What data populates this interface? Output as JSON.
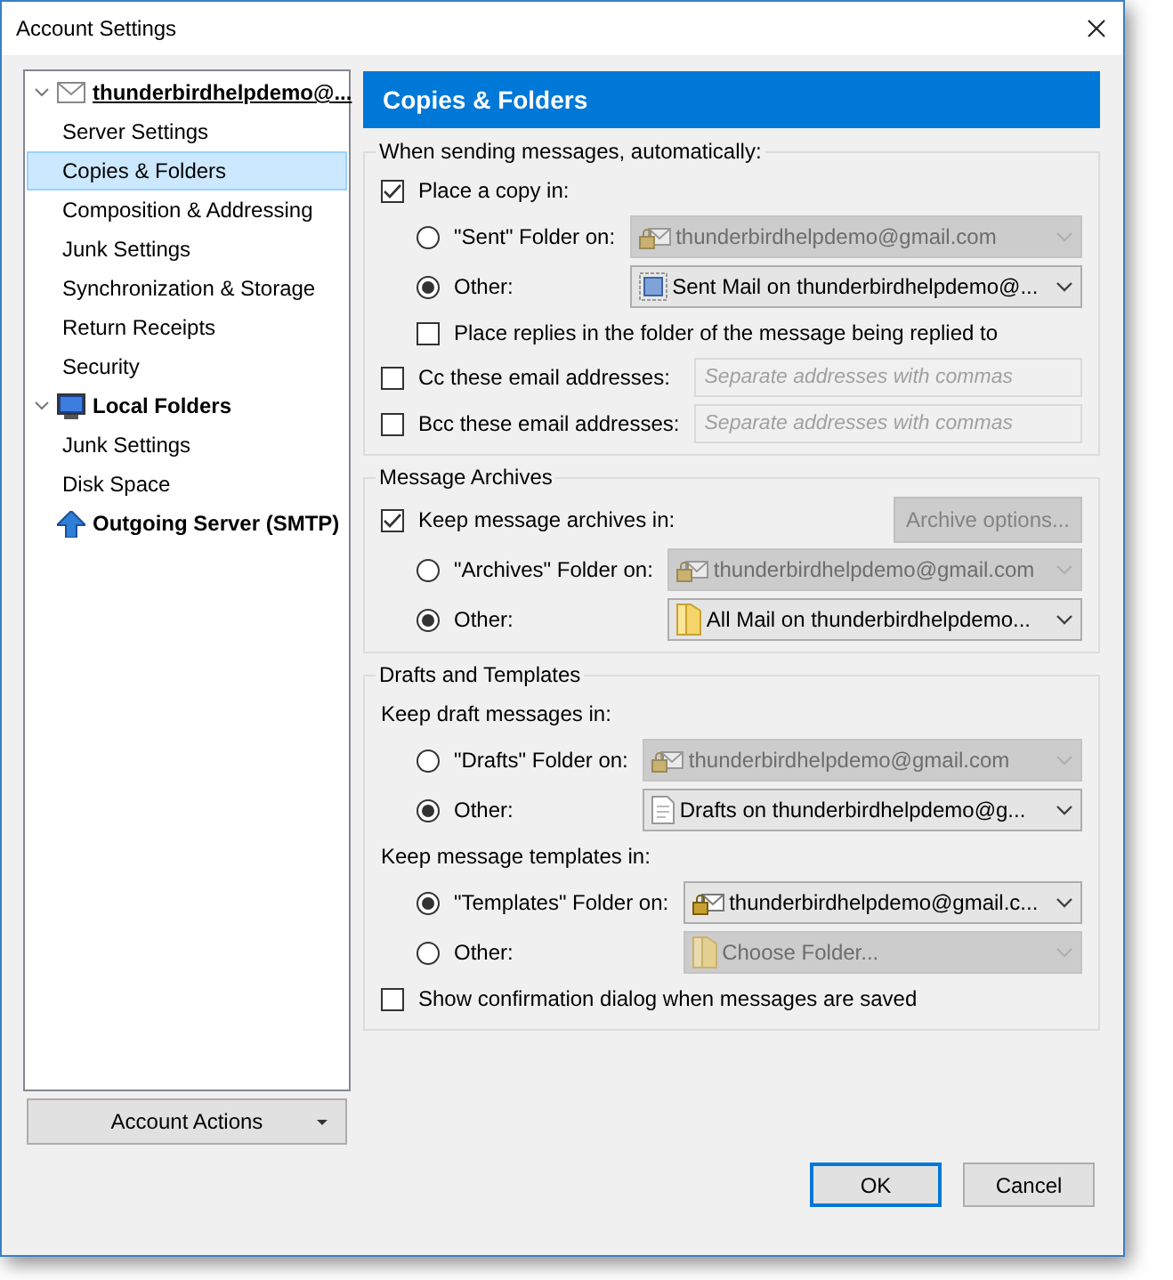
{
  "window": {
    "title": "Account Settings"
  },
  "sidebar": {
    "items": [
      {
        "label": "thunderbirdhelpdemo@...",
        "kind": "mail",
        "expanded": true,
        "selected": false,
        "children": [
          {
            "label": "Server Settings",
            "selected": false
          },
          {
            "label": "Copies & Folders",
            "selected": true
          },
          {
            "label": "Composition & Addressing",
            "selected": false
          },
          {
            "label": "Junk Settings",
            "selected": false
          },
          {
            "label": "Synchronization & Storage",
            "selected": false
          },
          {
            "label": "Return Receipts",
            "selected": false
          },
          {
            "label": "Security",
            "selected": false
          }
        ]
      },
      {
        "label": "Local Folders",
        "kind": "computer",
        "expanded": true,
        "selected": false,
        "children": [
          {
            "label": "Junk Settings",
            "selected": false
          },
          {
            "label": "Disk Space",
            "selected": false
          }
        ]
      },
      {
        "label": "Outgoing Server (SMTP)",
        "kind": "server",
        "selected": false
      }
    ],
    "actions_button": "Account Actions"
  },
  "panel": {
    "title": "Copies & Folders",
    "groups": [
      {
        "legend": "When sending messages, automatically:",
        "rows": [
          {
            "kind": "checkbox",
            "label": "Place a copy in:",
            "checked": true
          },
          {
            "kind": "radio",
            "label": "\"Sent\" Folder on:",
            "selected": false,
            "select": {
              "value": "thunderbirdhelpdemo@gmail.com",
              "kind": "account",
              "disabled": true
            }
          },
          {
            "kind": "radio",
            "label": "Other:",
            "selected": true,
            "select": {
              "value": "Sent Mail on thunderbirdhelpdemo@...",
              "kind": "sent",
              "disabled": false
            }
          },
          {
            "kind": "sub_checkbox",
            "label": "Place replies in the folder of the message being replied to",
            "checked": false
          },
          {
            "kind": "checkbox_input",
            "label": "Cc these email addresses:",
            "checked": false,
            "placeholder": "Separate addresses with commas"
          },
          {
            "kind": "checkbox_input",
            "label": "Bcc these email addresses:",
            "checked": false,
            "placeholder": "Separate addresses with commas"
          }
        ]
      },
      {
        "legend": "Message Archives",
        "rows": [
          {
            "kind": "checkbox",
            "label": "Keep message archives in:",
            "checked": true,
            "button": {
              "label": "Archive options...",
              "disabled": true
            }
          },
          {
            "kind": "radio",
            "label": "\"Archives\" Folder on:",
            "selected": false,
            "select": {
              "value": "thunderbirdhelpdemo@gmail.com",
              "kind": "account",
              "disabled": true
            }
          },
          {
            "kind": "radio",
            "label": "Other:",
            "selected": true,
            "select": {
              "value": "All Mail on thunderbirdhelpdemo...",
              "kind": "folder",
              "disabled": false
            }
          }
        ]
      },
      {
        "legend": "Drafts and Templates",
        "rows": [
          {
            "kind": "heading",
            "label": "Keep draft messages in:"
          },
          {
            "kind": "radio",
            "label": "\"Drafts\" Folder on:",
            "selected": false,
            "select": {
              "value": "thunderbirdhelpdemo@gmail.com",
              "kind": "account",
              "disabled": true
            }
          },
          {
            "kind": "radio",
            "label": "Other:",
            "selected": true,
            "select": {
              "value": "Drafts on thunderbirdhelpdemo@g...",
              "kind": "draft",
              "disabled": false
            }
          },
          {
            "kind": "heading",
            "label": "Keep message templates in:"
          },
          {
            "kind": "radio",
            "label": "\"Templates\" Folder on:",
            "selected": true,
            "select": {
              "value": "thunderbirdhelpdemo@gmail.c...",
              "kind": "account",
              "disabled": false
            }
          },
          {
            "kind": "radio",
            "label": "Other:",
            "selected": false,
            "select": {
              "value": "Choose Folder...",
              "kind": "folder",
              "disabled": true
            }
          },
          {
            "kind": "checkbox",
            "label": "Show confirmation dialog when messages are saved",
            "checked": false
          }
        ]
      }
    ]
  },
  "buttons": [
    {
      "label": "OK",
      "default": true
    },
    {
      "label": "Cancel",
      "default": false
    }
  ]
}
